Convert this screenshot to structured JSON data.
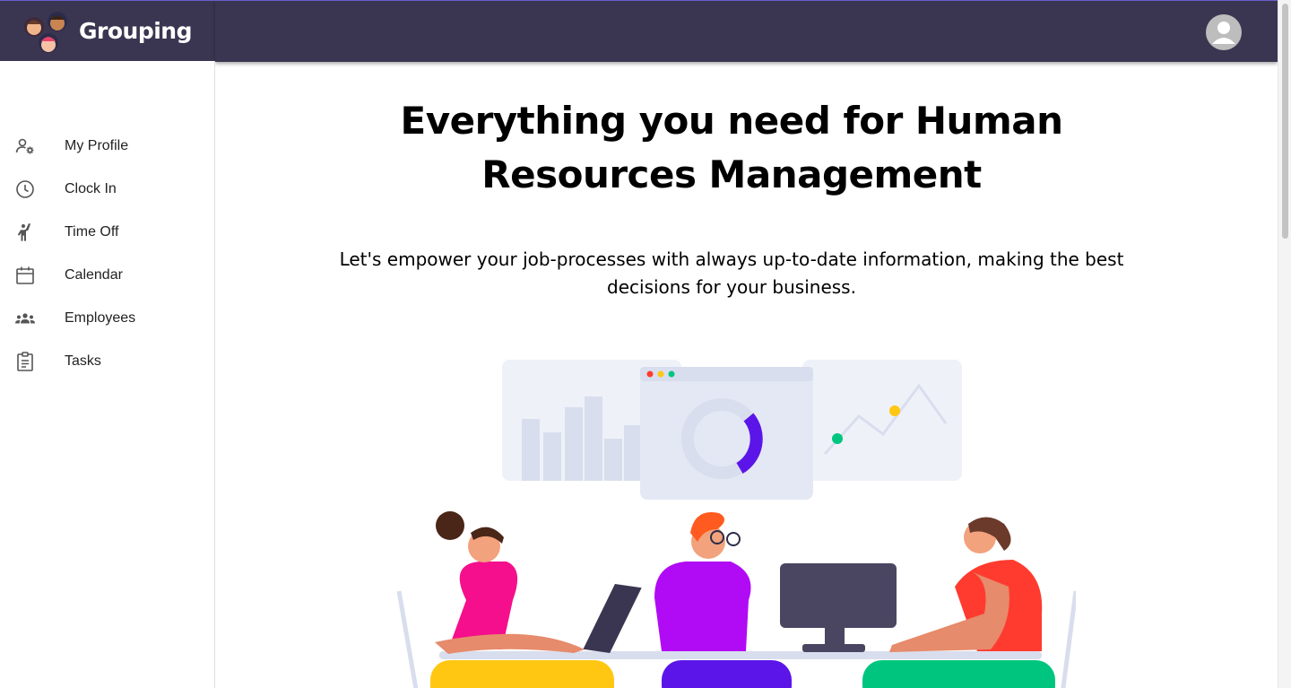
{
  "app": {
    "name": "Grouping"
  },
  "header": {
    "avatar_icon": "account-circle-icon"
  },
  "sidebar": {
    "items": [
      {
        "label": "My Profile",
        "icon": "manage-accounts-icon"
      },
      {
        "label": "Clock In",
        "icon": "clock-icon"
      },
      {
        "label": "Time Off",
        "icon": "person-raising-hand-icon"
      },
      {
        "label": "Calendar",
        "icon": "calendar-icon"
      },
      {
        "label": "Employees",
        "icon": "groups-icon"
      },
      {
        "label": "Tasks",
        "icon": "clipboard-icon"
      }
    ]
  },
  "main": {
    "headline": "Everything you need for Human Resources Management",
    "subhead": "Let's empower your job-processes with always up-to-date information, making the best decisions for your business."
  },
  "colors": {
    "topbar": "#3a3651",
    "accent": "#6a5fd0",
    "green": "#00c57f",
    "yellow": "#ffc712",
    "purple": "#b10bf5",
    "pink": "#f50f8c",
    "red": "#ff3b2f"
  }
}
